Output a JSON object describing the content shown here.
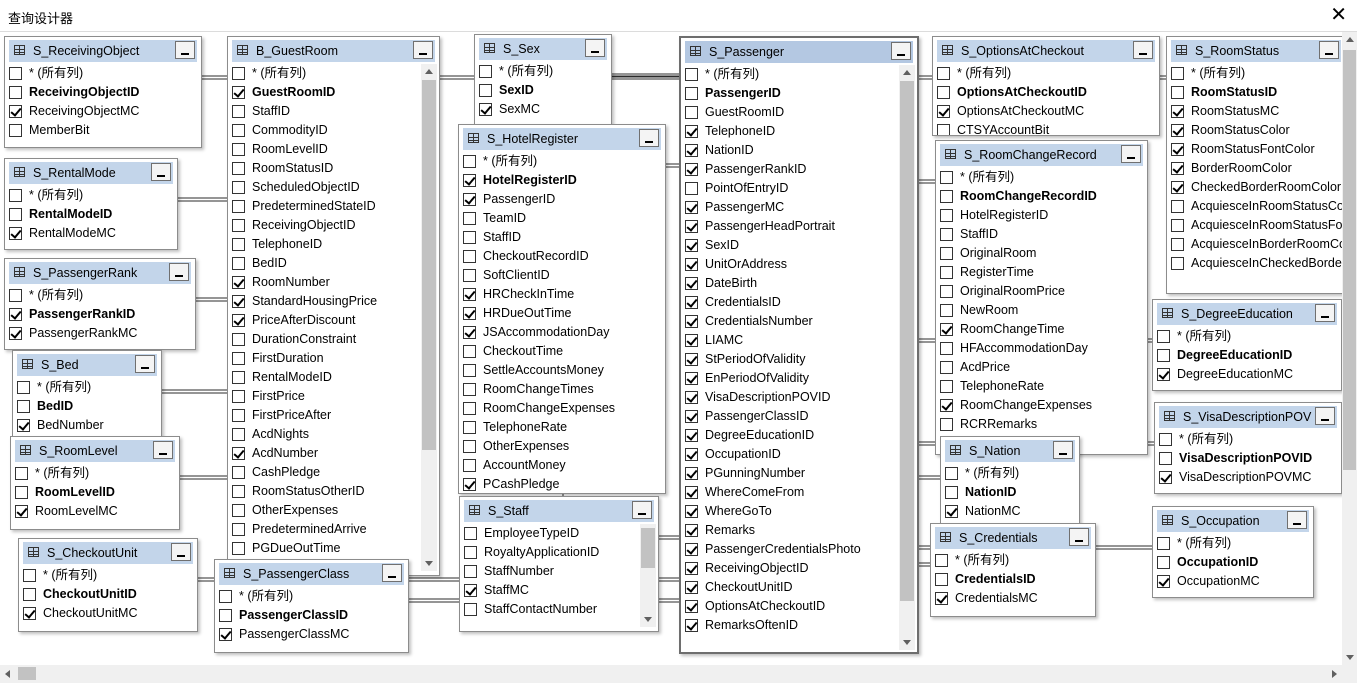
{
  "window": {
    "title": "查询设计器",
    "close_glyph": "✕"
  },
  "all_columns_label": "* (所有列)",
  "tables": [
    {
      "name": "S_ReceivingObject",
      "rows": [
        {
          "label": "ReceivingObjectID",
          "checked": false,
          "pk": true
        },
        {
          "label": "ReceivingObjectMC",
          "checked": true,
          "pk": false
        },
        {
          "label": "MemberBit",
          "checked": false,
          "pk": false
        }
      ]
    },
    {
      "name": "B_GuestRoom",
      "rows": [
        {
          "label": "GuestRoomID",
          "checked": true,
          "pk": true
        },
        {
          "label": "StaffID",
          "checked": false,
          "pk": false
        },
        {
          "label": "CommodityID",
          "checked": false,
          "pk": false
        },
        {
          "label": "RoomLevelID",
          "checked": false,
          "pk": false
        },
        {
          "label": "RoomStatusID",
          "checked": false,
          "pk": false
        },
        {
          "label": "ScheduledObjectID",
          "checked": false,
          "pk": false
        },
        {
          "label": "PredeterminedStateID",
          "checked": false,
          "pk": false
        },
        {
          "label": "ReceivingObjectID",
          "checked": false,
          "pk": false
        },
        {
          "label": "TelephoneID",
          "checked": false,
          "pk": false
        },
        {
          "label": "BedID",
          "checked": false,
          "pk": false
        },
        {
          "label": "RoomNumber",
          "checked": true,
          "pk": false
        },
        {
          "label": "StandardHousingPrice",
          "checked": true,
          "pk": false
        },
        {
          "label": "PriceAfterDiscount",
          "checked": true,
          "pk": false
        },
        {
          "label": "DurationConstraint",
          "checked": false,
          "pk": false
        },
        {
          "label": "FirstDuration",
          "checked": false,
          "pk": false
        },
        {
          "label": "RentalModeID",
          "checked": false,
          "pk": false
        },
        {
          "label": "FirstPrice",
          "checked": false,
          "pk": false
        },
        {
          "label": "FirstPriceAfter",
          "checked": false,
          "pk": false
        },
        {
          "label": "AcdNights",
          "checked": false,
          "pk": false
        },
        {
          "label": "AcdNumber",
          "checked": true,
          "pk": false
        },
        {
          "label": "CashPledge",
          "checked": false,
          "pk": false
        },
        {
          "label": "RoomStatusOtherID",
          "checked": false,
          "pk": false
        },
        {
          "label": "OtherExpenses",
          "checked": false,
          "pk": false
        },
        {
          "label": "PredeterminedArrive",
          "checked": false,
          "pk": false
        },
        {
          "label": "PGDueOutTime",
          "checked": false,
          "pk": false
        }
      ]
    },
    {
      "name": "S_Sex",
      "rows": [
        {
          "label": "SexID",
          "checked": false,
          "pk": true
        },
        {
          "label": "SexMC",
          "checked": true,
          "pk": false
        }
      ]
    },
    {
      "name": "S_Passenger",
      "rows": [
        {
          "label": "PassengerID",
          "checked": false,
          "pk": true
        },
        {
          "label": "GuestRoomID",
          "checked": false,
          "pk": false
        },
        {
          "label": "TelephoneID",
          "checked": true,
          "pk": false
        },
        {
          "label": "NationID",
          "checked": true,
          "pk": false
        },
        {
          "label": "PassengerRankID",
          "checked": true,
          "pk": false
        },
        {
          "label": "PointOfEntryID",
          "checked": false,
          "pk": false
        },
        {
          "label": "PassengerMC",
          "checked": true,
          "pk": false
        },
        {
          "label": "PassengerHeadPortrait",
          "checked": true,
          "pk": false
        },
        {
          "label": "SexID",
          "checked": true,
          "pk": false
        },
        {
          "label": "UnitOrAddress",
          "checked": true,
          "pk": false
        },
        {
          "label": "DateBirth",
          "checked": true,
          "pk": false
        },
        {
          "label": "CredentialsID",
          "checked": true,
          "pk": false
        },
        {
          "label": "CredentialsNumber",
          "checked": true,
          "pk": false
        },
        {
          "label": "LIAMC",
          "checked": true,
          "pk": false
        },
        {
          "label": "StPeriodOfValidity",
          "checked": true,
          "pk": false
        },
        {
          "label": "EnPeriodOfValidity",
          "checked": true,
          "pk": false
        },
        {
          "label": "VisaDescriptionPOVID",
          "checked": true,
          "pk": false
        },
        {
          "label": "PassengerClassID",
          "checked": true,
          "pk": false
        },
        {
          "label": "DegreeEducationID",
          "checked": true,
          "pk": false
        },
        {
          "label": "OccupationID",
          "checked": true,
          "pk": false
        },
        {
          "label": "PGunningNumber",
          "checked": true,
          "pk": false
        },
        {
          "label": "WhereComeFrom",
          "checked": true,
          "pk": false
        },
        {
          "label": "WhereGoTo",
          "checked": true,
          "pk": false
        },
        {
          "label": "Remarks",
          "checked": true,
          "pk": false
        },
        {
          "label": "PassengerCredentialsPhoto",
          "checked": true,
          "pk": false
        },
        {
          "label": "ReceivingObjectID",
          "checked": true,
          "pk": false
        },
        {
          "label": "CheckoutUnitID",
          "checked": true,
          "pk": false
        },
        {
          "label": "OptionsAtCheckoutID",
          "checked": true,
          "pk": false
        },
        {
          "label": "RemarksOftenID",
          "checked": true,
          "pk": false
        }
      ]
    },
    {
      "name": "S_OptionsAtCheckout",
      "rows": [
        {
          "label": "OptionsAtCheckoutID",
          "checked": false,
          "pk": true
        },
        {
          "label": "OptionsAtCheckoutMC",
          "checked": true,
          "pk": false
        },
        {
          "label": "CTSYAccountBit",
          "checked": false,
          "pk": false
        }
      ]
    },
    {
      "name": "S_RoomStatus",
      "rows": [
        {
          "label": "RoomStatusID",
          "checked": false,
          "pk": true
        },
        {
          "label": "RoomStatusMC",
          "checked": true,
          "pk": false
        },
        {
          "label": "RoomStatusColor",
          "checked": true,
          "pk": false
        },
        {
          "label": "RoomStatusFontColor",
          "checked": true,
          "pk": false
        },
        {
          "label": "BorderRoomColor",
          "checked": true,
          "pk": false
        },
        {
          "label": "CheckedBorderRoomColor",
          "checked": true,
          "pk": false
        },
        {
          "label": "AcquiesceInRoomStatusColor",
          "checked": false,
          "pk": false
        },
        {
          "label": "AcquiesceInRoomStatusFontColor",
          "checked": false,
          "pk": false
        },
        {
          "label": "AcquiesceInBorderRoomColor",
          "checked": false,
          "pk": false
        },
        {
          "label": "AcquiesceInCheckedBorderRoomColor",
          "checked": false,
          "pk": false
        }
      ]
    },
    {
      "name": "S_RentalMode",
      "rows": [
        {
          "label": "RentalModeID",
          "checked": false,
          "pk": true
        },
        {
          "label": "RentalModeMC",
          "checked": true,
          "pk": false
        }
      ]
    },
    {
      "name": "S_HotelRegister",
      "rows": [
        {
          "label": "HotelRegisterID",
          "checked": true,
          "pk": true
        },
        {
          "label": "PassengerID",
          "checked": true,
          "pk": false
        },
        {
          "label": "TeamID",
          "checked": false,
          "pk": false
        },
        {
          "label": "StaffID",
          "checked": false,
          "pk": false
        },
        {
          "label": "CheckoutRecordID",
          "checked": false,
          "pk": false
        },
        {
          "label": "SoftClientID",
          "checked": false,
          "pk": false
        },
        {
          "label": "HRCheckInTime",
          "checked": true,
          "pk": false
        },
        {
          "label": "HRDueOutTime",
          "checked": true,
          "pk": false
        },
        {
          "label": "JSAccommodationDay",
          "checked": true,
          "pk": false
        },
        {
          "label": "CheckoutTime",
          "checked": false,
          "pk": false
        },
        {
          "label": "SettleAccountsMoney",
          "checked": false,
          "pk": false
        },
        {
          "label": "RoomChangeTimes",
          "checked": false,
          "pk": false
        },
        {
          "label": "RoomChangeExpenses",
          "checked": false,
          "pk": false
        },
        {
          "label": "TelephoneRate",
          "checked": false,
          "pk": false
        },
        {
          "label": "OtherExpenses",
          "checked": false,
          "pk": false
        },
        {
          "label": "AccountMoney",
          "checked": false,
          "pk": false
        },
        {
          "label": "PCashPledge",
          "checked": true,
          "pk": false
        }
      ]
    },
    {
      "name": "S_RoomChangeRecord",
      "rows": [
        {
          "label": "RoomChangeRecordID",
          "checked": false,
          "pk": true
        },
        {
          "label": "HotelRegisterID",
          "checked": false,
          "pk": false
        },
        {
          "label": "StaffID",
          "checked": false,
          "pk": false
        },
        {
          "label": "OriginalRoom",
          "checked": false,
          "pk": false
        },
        {
          "label": "RegisterTime",
          "checked": false,
          "pk": false
        },
        {
          "label": "OriginalRoomPrice",
          "checked": false,
          "pk": false
        },
        {
          "label": "NewRoom",
          "checked": false,
          "pk": false
        },
        {
          "label": "RoomChangeTime",
          "checked": true,
          "pk": false
        },
        {
          "label": "HFAccommodationDay",
          "checked": false,
          "pk": false
        },
        {
          "label": "AcdPrice",
          "checked": false,
          "pk": false
        },
        {
          "label": "TelephoneRate",
          "checked": false,
          "pk": false
        },
        {
          "label": "RoomChangeExpenses",
          "checked": true,
          "pk": false
        },
        {
          "label": "RCRRemarks",
          "checked": false,
          "pk": false
        }
      ]
    },
    {
      "name": "S_PassengerRank",
      "rows": [
        {
          "label": "PassengerRankID",
          "checked": true,
          "pk": true
        },
        {
          "label": "PassengerRankMC",
          "checked": true,
          "pk": false
        }
      ]
    },
    {
      "name": "S_DegreeEducation",
      "rows": [
        {
          "label": "DegreeEducationID",
          "checked": false,
          "pk": true
        },
        {
          "label": "DegreeEducationMC",
          "checked": true,
          "pk": false
        }
      ]
    },
    {
      "name": "S_Bed",
      "rows": [
        {
          "label": "BedID",
          "checked": false,
          "pk": true
        },
        {
          "label": "BedNumber",
          "checked": true,
          "pk": false
        }
      ]
    },
    {
      "name": "S_VisaDescriptionPOV",
      "rows": [
        {
          "label": "VisaDescriptionPOVID",
          "checked": false,
          "pk": true
        },
        {
          "label": "VisaDescriptionPOVMC",
          "checked": true,
          "pk": false
        }
      ]
    },
    {
      "name": "S_RoomLevel",
      "rows": [
        {
          "label": "RoomLevelID",
          "checked": false,
          "pk": true
        },
        {
          "label": "RoomLevelMC",
          "checked": true,
          "pk": false
        }
      ]
    },
    {
      "name": "S_Nation",
      "rows": [
        {
          "label": "NationID",
          "checked": false,
          "pk": true
        },
        {
          "label": "NationMC",
          "checked": true,
          "pk": false
        }
      ]
    },
    {
      "name": "S_Staff",
      "rows": [
        {
          "label": "EmployeeTypeID",
          "checked": false,
          "pk": false
        },
        {
          "label": "RoyaltyApplicationID",
          "checked": false,
          "pk": false
        },
        {
          "label": "StaffNumber",
          "checked": false,
          "pk": false
        },
        {
          "label": "StaffMC",
          "checked": true,
          "pk": false
        },
        {
          "label": "StaffContactNumber",
          "checked": false,
          "pk": false
        }
      ]
    },
    {
      "name": "S_Occupation",
      "rows": [
        {
          "label": "OccupationID",
          "checked": false,
          "pk": true
        },
        {
          "label": "OccupationMC",
          "checked": true,
          "pk": false
        }
      ]
    },
    {
      "name": "S_CheckoutUnit",
      "rows": [
        {
          "label": "CheckoutUnitID",
          "checked": false,
          "pk": true
        },
        {
          "label": "CheckoutUnitMC",
          "checked": true,
          "pk": false
        }
      ]
    },
    {
      "name": "S_Credentials",
      "rows": [
        {
          "label": "CredentialsID",
          "checked": false,
          "pk": true
        },
        {
          "label": "CredentialsMC",
          "checked": true,
          "pk": false
        }
      ]
    },
    {
      "name": "S_PassengerClass",
      "rows": [
        {
          "label": "PassengerClassID",
          "checked": false,
          "pk": true
        },
        {
          "label": "PassengerClassMC",
          "checked": true,
          "pk": false
        }
      ]
    }
  ]
}
